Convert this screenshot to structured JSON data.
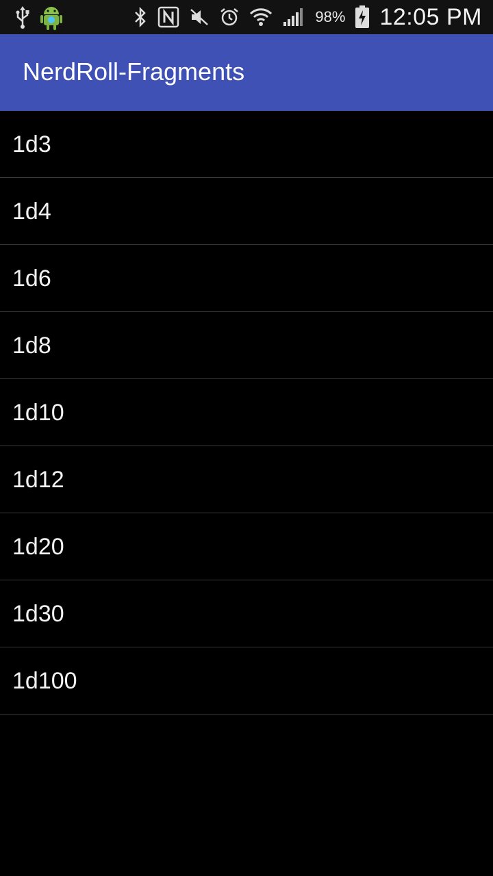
{
  "status_bar": {
    "icons_left": [
      "usb-icon",
      "android-icon"
    ],
    "icons_right": [
      "bluetooth-icon",
      "nfc-icon",
      "mute-icon",
      "alarm-icon",
      "wifi-icon",
      "signal-icon",
      "battery-icon"
    ],
    "battery_percent": "98%",
    "time": "12:05 PM"
  },
  "app_bar": {
    "title": "NerdRoll-Fragments",
    "color": "#3F51B5"
  },
  "dice_list": {
    "items": [
      {
        "label": "1d3"
      },
      {
        "label": "1d4"
      },
      {
        "label": "1d6"
      },
      {
        "label": "1d8"
      },
      {
        "label": "1d10"
      },
      {
        "label": "1d12"
      },
      {
        "label": "1d20"
      },
      {
        "label": "1d30"
      },
      {
        "label": "1d100"
      }
    ]
  }
}
